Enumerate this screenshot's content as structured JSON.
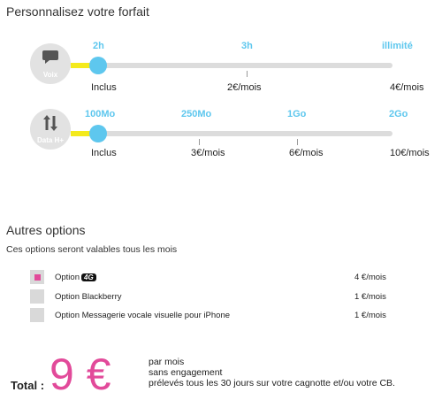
{
  "page_title": "Personnalisez votre forfait",
  "sliders": [
    {
      "category": "Voix",
      "icon": "speech-bubble-icon",
      "value_fraction": 0,
      "stops": [
        {
          "label": "2h",
          "price": "Inclus"
        },
        {
          "label": "3h",
          "price": "2€/mois"
        },
        {
          "label": "illimité",
          "price": "4€/mois"
        }
      ]
    },
    {
      "category": "Data H+",
      "icon": "up-down-arrows-icon",
      "value_fraction": 0,
      "stops": [
        {
          "label": "100Mo",
          "price": "Inclus"
        },
        {
          "label": "250Mo",
          "price": "3€/mois"
        },
        {
          "label": "1Go",
          "price": "6€/mois"
        },
        {
          "label": "2Go",
          "price": "10€/mois"
        }
      ]
    }
  ],
  "options_section": {
    "title": "Autres options",
    "subtitle": "Ces options seront valables tous les mois",
    "items": [
      {
        "label": "Option",
        "badge": "4G",
        "price": "4 €/mois",
        "checked": true
      },
      {
        "label": "Option Blackberry",
        "price": "1 €/mois",
        "checked": false
      },
      {
        "label": "Option Messagerie vocale visuelle pour iPhone",
        "price": "1 €/mois",
        "checked": false
      }
    ]
  },
  "total": {
    "label": "Total :",
    "value": "9 €",
    "lines": [
      "par mois",
      "sans engagement",
      "prélevés tous les 30 jours sur votre cagnotte et/ou votre CB."
    ]
  },
  "colors": {
    "accent": "#5ec7ee",
    "fill": "#f4ea1c",
    "highlight": "#e24a9a",
    "track": "#dcdcdc"
  }
}
